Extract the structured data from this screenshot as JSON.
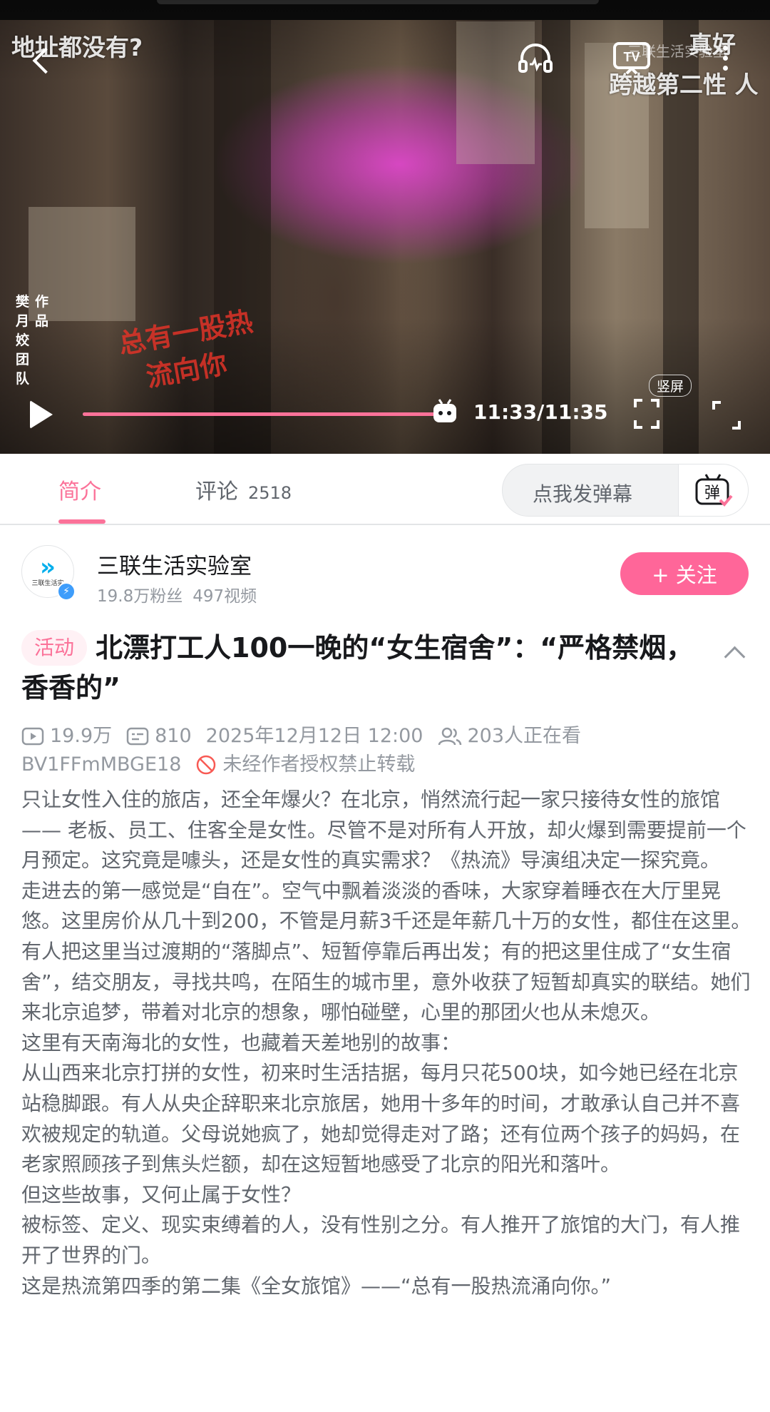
{
  "player": {
    "danmaku_left": "地址都没有?",
    "danmaku_right_1": "真好",
    "danmaku_right_2": "跨越第二性 人",
    "watermark": "三联生活实验室",
    "credit_col1": [
      "樊",
      "月",
      "姣",
      "团",
      "队"
    ],
    "credit_col2": [
      "作",
      "品"
    ],
    "stamp_line1": "总有一股热",
    "stamp_line2": "流向你",
    "time": "11:33/11:35",
    "progress": 0.997,
    "vertical_label": "竖屏",
    "icons": [
      "back-icon",
      "listen-icon",
      "tv-icon",
      "more-icon",
      "play-icon",
      "portrait-icon",
      "fullscreen-icon"
    ]
  },
  "tabs": {
    "intro": "简介",
    "comments": "评论",
    "comments_count": "2518",
    "danmaku_placeholder": "点我发弹幕",
    "danmaku_button": "弹"
  },
  "uploader": {
    "name": "三联生活实验室",
    "fans": "19.8万粉丝",
    "videos": "497视频",
    "follow": "+ 关注",
    "logo_text": "三联生活实"
  },
  "video": {
    "badge": "活动",
    "title": "北漂打工人100一晚的“女生宿舍”：“严格禁烟，香香的”",
    "views": "19.9万",
    "danmaku_count": "810",
    "datetime": "2025年12月12日 12:00",
    "watching": "203人正在看",
    "bvid": "BV1FFmMBGE18",
    "no_repost": "未经作者授权禁止转载",
    "description": [
      "只让女性入住的旅店，还全年爆火？在北京，悄然流行起一家只接待女性的旅馆—— 老板、员工、住客全是女性。尽管不是对所有人开放，却火爆到需要提前一个月预定。这究竟是噱头，还是女性的真实需求？《热流》导演组决定一探究竟。",
      "走进去的第一感觉是“自在”。空气中飘着淡淡的香味，大家穿着睡衣在大厅里晃悠。这里房价从几十到200，不管是月薪3千还是年薪几十万的女性，都住在这里。有人把这里当过渡期的“落脚点”、短暂停靠后再出发；有的把这里住成了“女生宿舍”，结交朋友，寻找共鸣，在陌生的城市里，意外收获了短暂却真实的联结。她们来北京追梦，带着对北京的想象，哪怕碰壁，心里的那团火也从未熄灭。",
      "这里有天南海北的女性，也藏着天差地别的故事：",
      "从山西来北京打拼的女性，初来时生活拮据，每月只花500块，如今她已经在北京站稳脚跟。有人从央企辞职来北京旅居，她用十多年的时间，才敢承认自己并不喜欢被规定的轨道。父母说她疯了，她却觉得走对了路；还有位两个孩子的妈妈，在老家照顾孩子到焦头烂额，却在这短暂地感受了北京的阳光和落叶。",
      "但这些故事，又何止属于女性？",
      "被标签、定义、现实束缚着的人，没有性别之分。有人推开了旅馆的大门，有人推开了世界的门。",
      "这是热流第四季的第二集《全女旅馆》——“总有一股热流涌向你。”"
    ]
  },
  "colors": {
    "accent": "#fb7299",
    "follow_bg": "#ff6699",
    "text_primary": "#18191c",
    "text_secondary": "#61666d",
    "text_meta": "#9499a0"
  }
}
